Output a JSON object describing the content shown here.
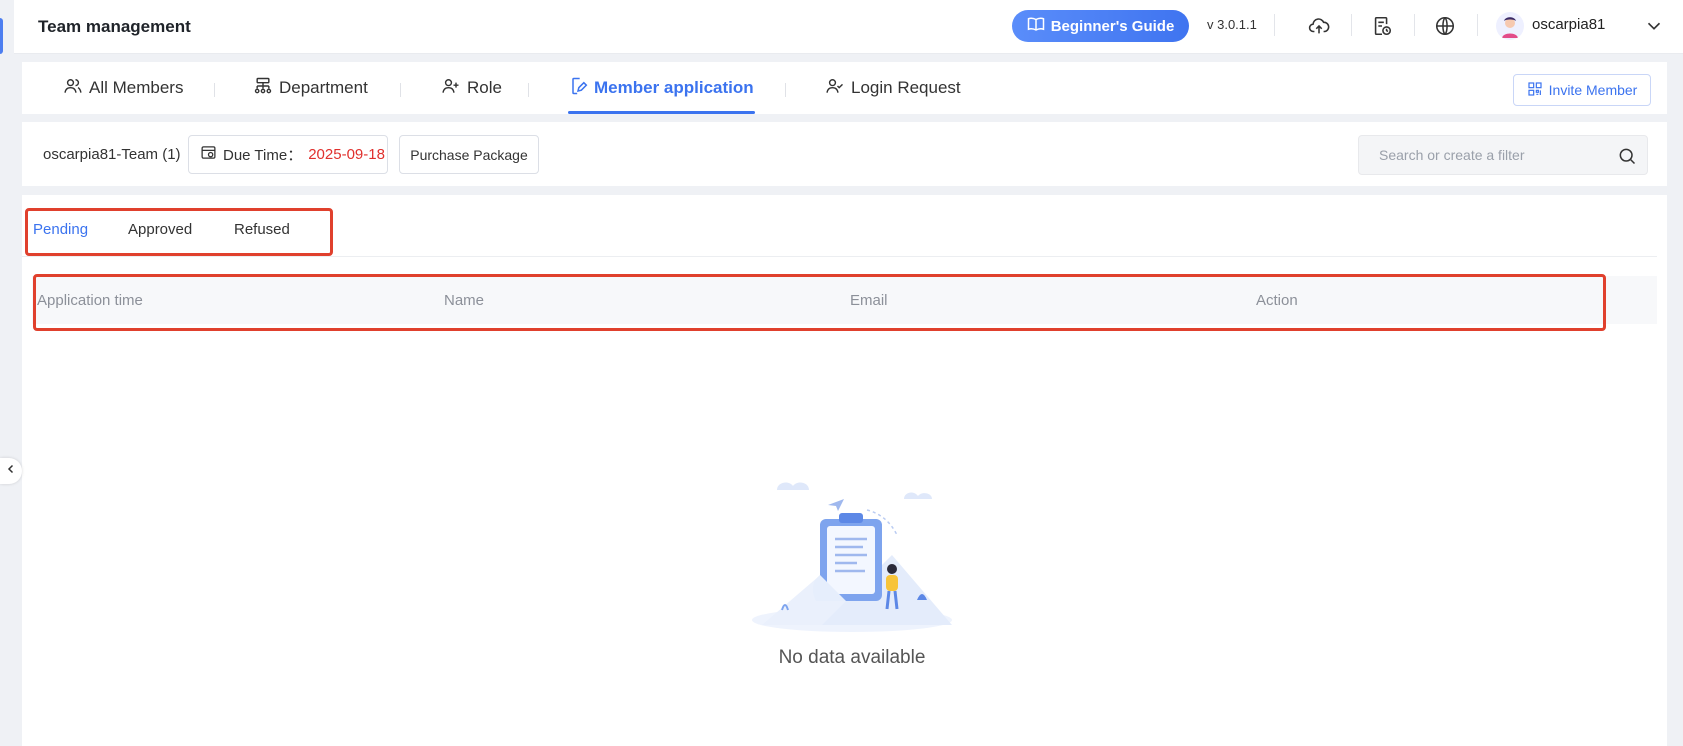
{
  "header": {
    "title": "Team management",
    "guide_label": "Beginner's Guide",
    "version": "v 3.0.1.1",
    "username": "oscarpia81"
  },
  "tabs": [
    {
      "label": "All Members"
    },
    {
      "label": "Department"
    },
    {
      "label": "Role"
    },
    {
      "label": "Member application",
      "active": true
    },
    {
      "label": "Login Request"
    }
  ],
  "invite_label": "Invite Member",
  "teambar": {
    "team_name": "oscarpia81-Team (1)",
    "due_label": "Due Time：",
    "due_date": "2025-09-18",
    "purchase_label": "Purchase Package",
    "search_placeholder": "Search or create a filter"
  },
  "status_tabs": [
    {
      "label": "Pending",
      "active": true
    },
    {
      "label": "Approved"
    },
    {
      "label": "Refused"
    }
  ],
  "table": {
    "columns": [
      "Application time",
      "Name",
      "Email",
      "Action"
    ]
  },
  "empty_text": "No data available",
  "colors": {
    "accent": "#3b73ef",
    "due_date": "#e0302d",
    "highlight_box": "#e0402d"
  }
}
